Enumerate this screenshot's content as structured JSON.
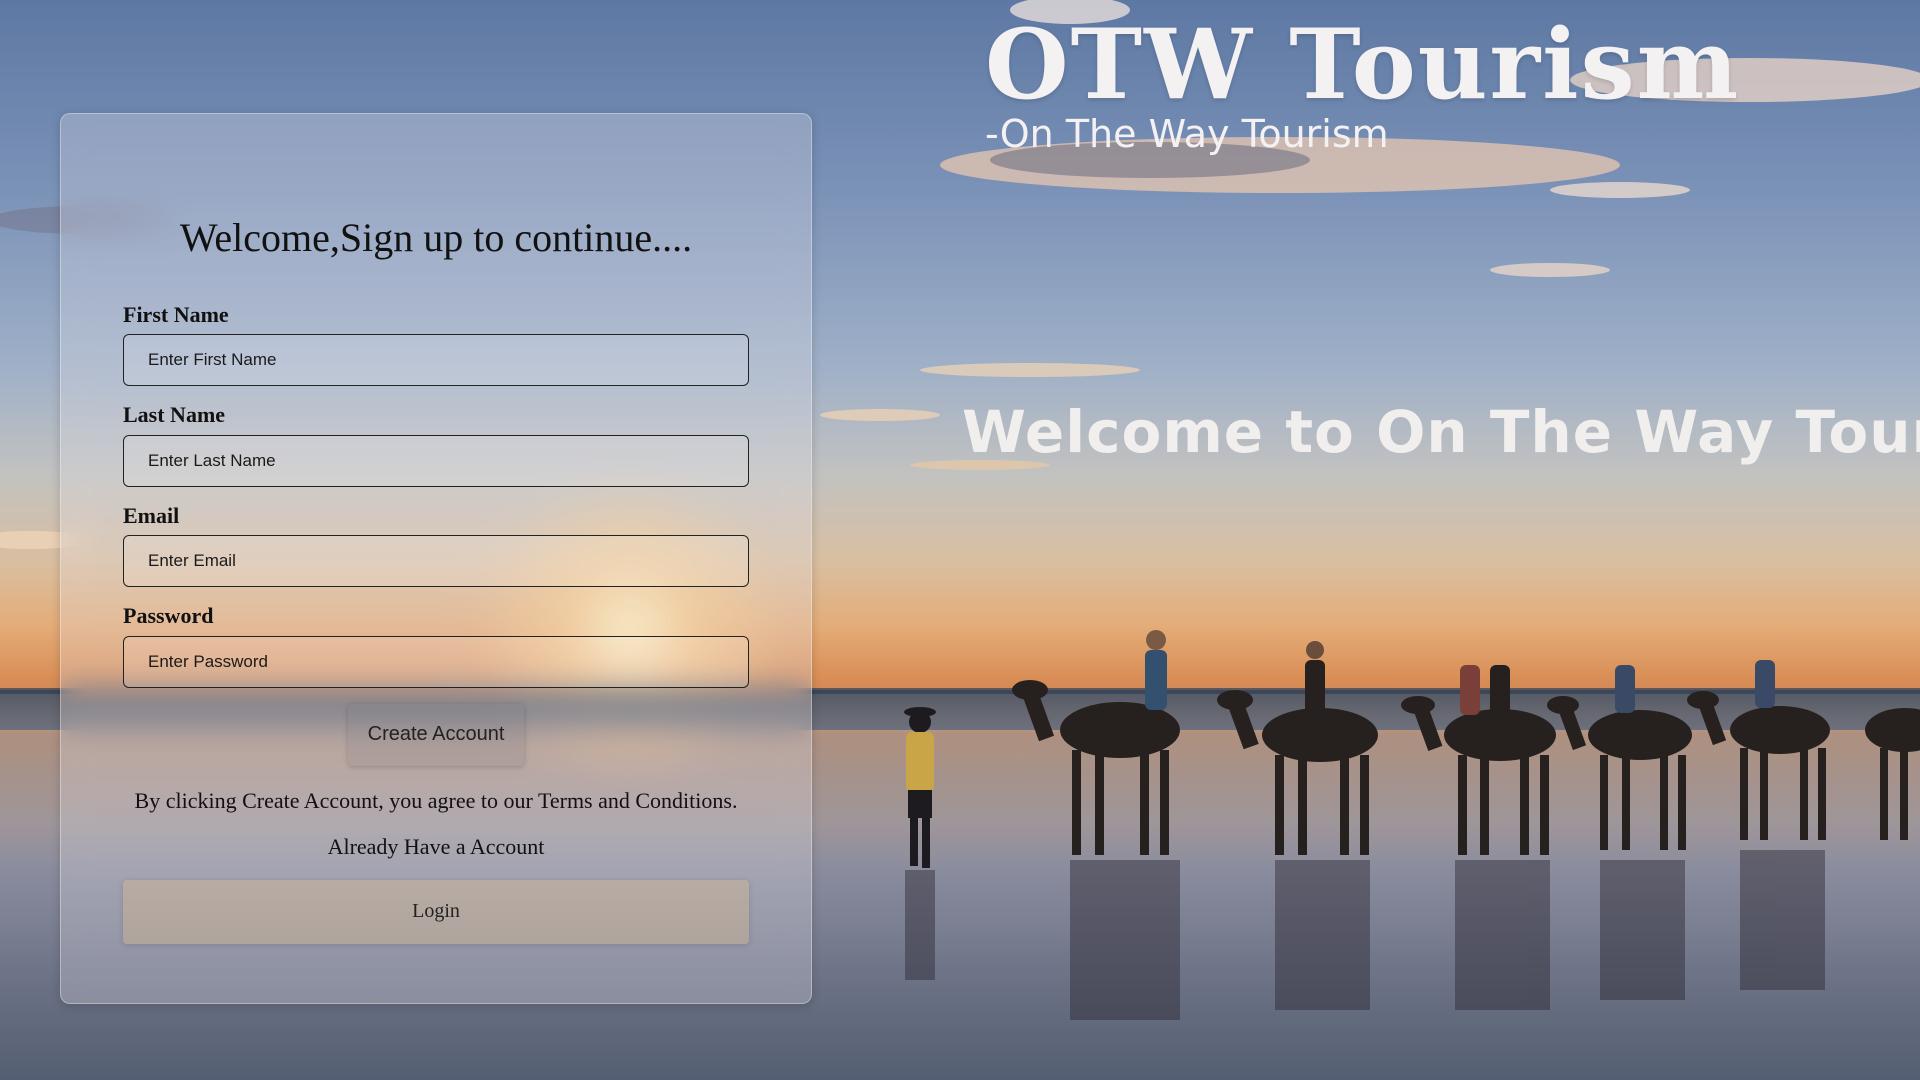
{
  "brand": {
    "title": "OTW Tourism",
    "subtitle": "-On The Way Tourism"
  },
  "hero": {
    "welcome": "Welcome to On The Way Tourism"
  },
  "signup": {
    "title": "Welcome,Sign up to continue....",
    "fields": {
      "first_name": {
        "label": "First Name",
        "placeholder": "Enter First Name"
      },
      "last_name": {
        "label": "Last Name",
        "placeholder": "Enter Last Name"
      },
      "email": {
        "label": "Email",
        "placeholder": "Enter Email"
      },
      "password": {
        "label": "Password",
        "placeholder": "Enter Password"
      }
    },
    "create_button": "Create Account",
    "terms_text": "By clicking Create Account, you agree to our Terms and Conditions.",
    "already_text": "Already Have a Account",
    "login_button": "Login"
  },
  "colors": {
    "brand_text": "#f4f1f2",
    "card_text": "#111111"
  }
}
